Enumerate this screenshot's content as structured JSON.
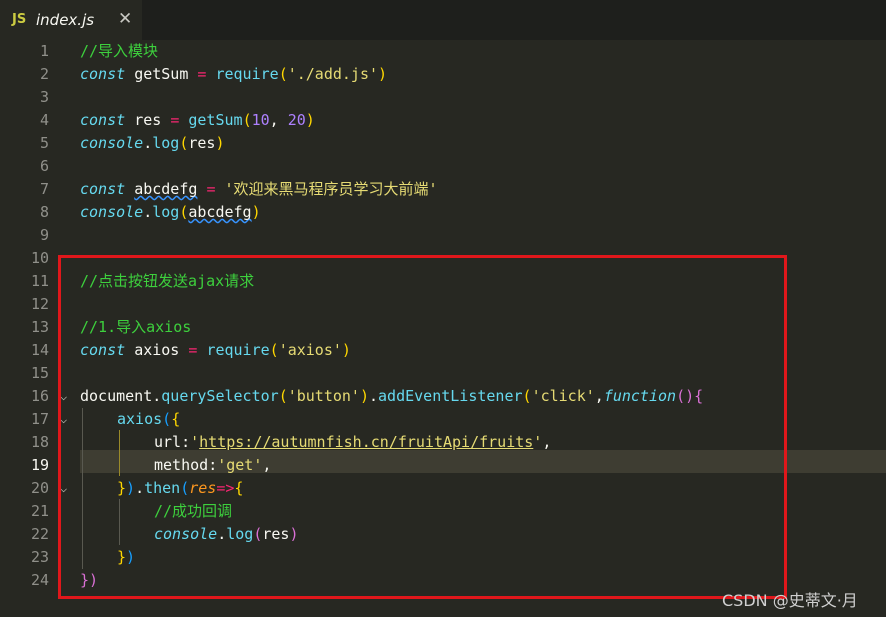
{
  "tab": {
    "badge": "JS",
    "filename": "index.js",
    "close_glyph": "✕"
  },
  "active_line": 19,
  "line_numbers": [
    "1",
    "2",
    "3",
    "4",
    "5",
    "6",
    "7",
    "8",
    "9",
    "10",
    "11",
    "12",
    "13",
    "14",
    "15",
    "16",
    "17",
    "18",
    "19",
    "20",
    "21",
    "22",
    "23",
    "24"
  ],
  "code": {
    "l1": {
      "comment": "//导入模块"
    },
    "l2": {
      "kw": "const",
      "var": "getSum",
      "eq": "=",
      "fn": "require",
      "arg": "'./add.js'"
    },
    "l4": {
      "kw": "const",
      "var": "res",
      "eq": "=",
      "fn": "getSum",
      "n1": "10",
      "n2": "20"
    },
    "l5": {
      "obj": "console",
      "method": "log",
      "arg": "res"
    },
    "l7": {
      "kw": "const",
      "var": "abcdefg",
      "eq": "=",
      "str": "'欢迎来黑马程序员学习大前端'"
    },
    "l8": {
      "obj": "console",
      "method": "log",
      "arg": "abcdefg"
    },
    "l11": {
      "comment": "//点击按钮发送ajax请求"
    },
    "l13": {
      "comment": "//1.导入axios"
    },
    "l14": {
      "kw": "const",
      "var": "axios",
      "eq": "=",
      "fn": "require",
      "arg": "'axios'"
    },
    "l16": {
      "obj": "document",
      "m1": "querySelector",
      "a1": "'button'",
      "m2": "addEventListener",
      "a2": "'click'",
      "kw": "function"
    },
    "l17": {
      "fn": "axios"
    },
    "l18": {
      "key": "url",
      "q1": "'",
      "url": "https://autumnfish.cn/fruitApi/fruits",
      "q2": "'"
    },
    "l19": {
      "key": "method",
      "val": "'get'"
    },
    "l20": {
      "method": "then",
      "param": "res",
      "arrow": "=>"
    },
    "l21": {
      "comment": "//成功回调"
    },
    "l22": {
      "obj": "console",
      "method": "log",
      "arg": "res"
    }
  },
  "colors": {
    "background": "#272822",
    "highlight_box": "#e0171b",
    "comment": "#3dd03d",
    "string": "#e6db74",
    "keyword": "#66d9ef",
    "number": "#ae81ff"
  },
  "watermark": "CSDN @史蒂文·月"
}
